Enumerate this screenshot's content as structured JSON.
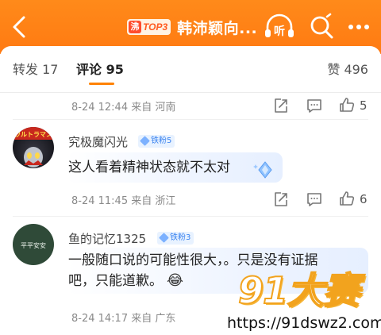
{
  "header": {
    "badge_fire": "沸",
    "badge_text": "TOP3",
    "title": "韩沛颖向...",
    "listen_label": "听",
    "colors": {
      "bg": "#ff7a12"
    }
  },
  "tabs": {
    "repost": "转发 17",
    "comment": "评论 95",
    "like": "赞 496"
  },
  "comments": [
    {
      "meta": "8-24 12:44 来自 河南",
      "likes": "5"
    },
    {
      "avatar_text": "ウルトラマン",
      "name": "究极魔闪光",
      "fan_badge": "铁粉5",
      "text": "这人看着精神状态就不太对",
      "meta": "8-24 11:45 来自 浙江",
      "likes": "6"
    },
    {
      "avatar_text": "平平安安",
      "name": "鱼的记忆1325",
      "fan_badge": "铁粉3",
      "text_line1": "一般随口说的可能性很大，。只是没有证据",
      "text_line2": "吧，只能道歉。",
      "emoji": "😂",
      "meta": "8-24 14:17 来自 广东"
    }
  ],
  "watermark": {
    "logo": "91大赛",
    "url": "https://91dswz2.com"
  }
}
